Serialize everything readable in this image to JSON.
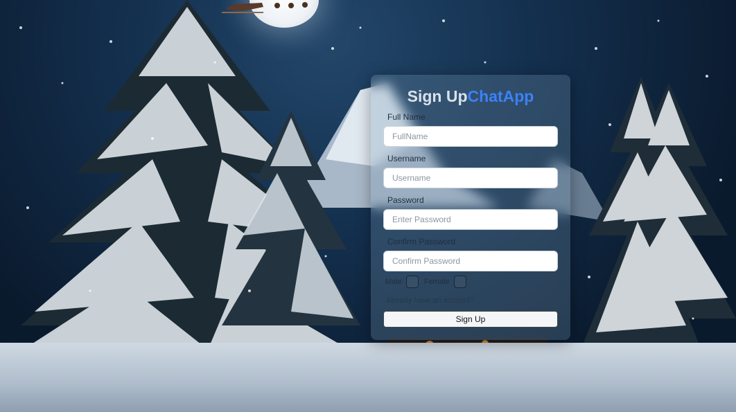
{
  "form": {
    "title_main": "Sign Up",
    "title_accent": "ChatApp",
    "accent_color": "#3b82f6",
    "fullname": {
      "label": "Full Name",
      "placeholder": "FullName"
    },
    "username": {
      "label": "Username",
      "placeholder": "Username"
    },
    "password": {
      "label": "Password",
      "placeholder": "Enter Password"
    },
    "confirm_password": {
      "label": "Confirm Password",
      "placeholder": "Confirm Password"
    },
    "gender": {
      "male_label": "Male",
      "female_label": "Female"
    },
    "login_link": "Already have an account?",
    "submit_label": "Sign Up"
  }
}
